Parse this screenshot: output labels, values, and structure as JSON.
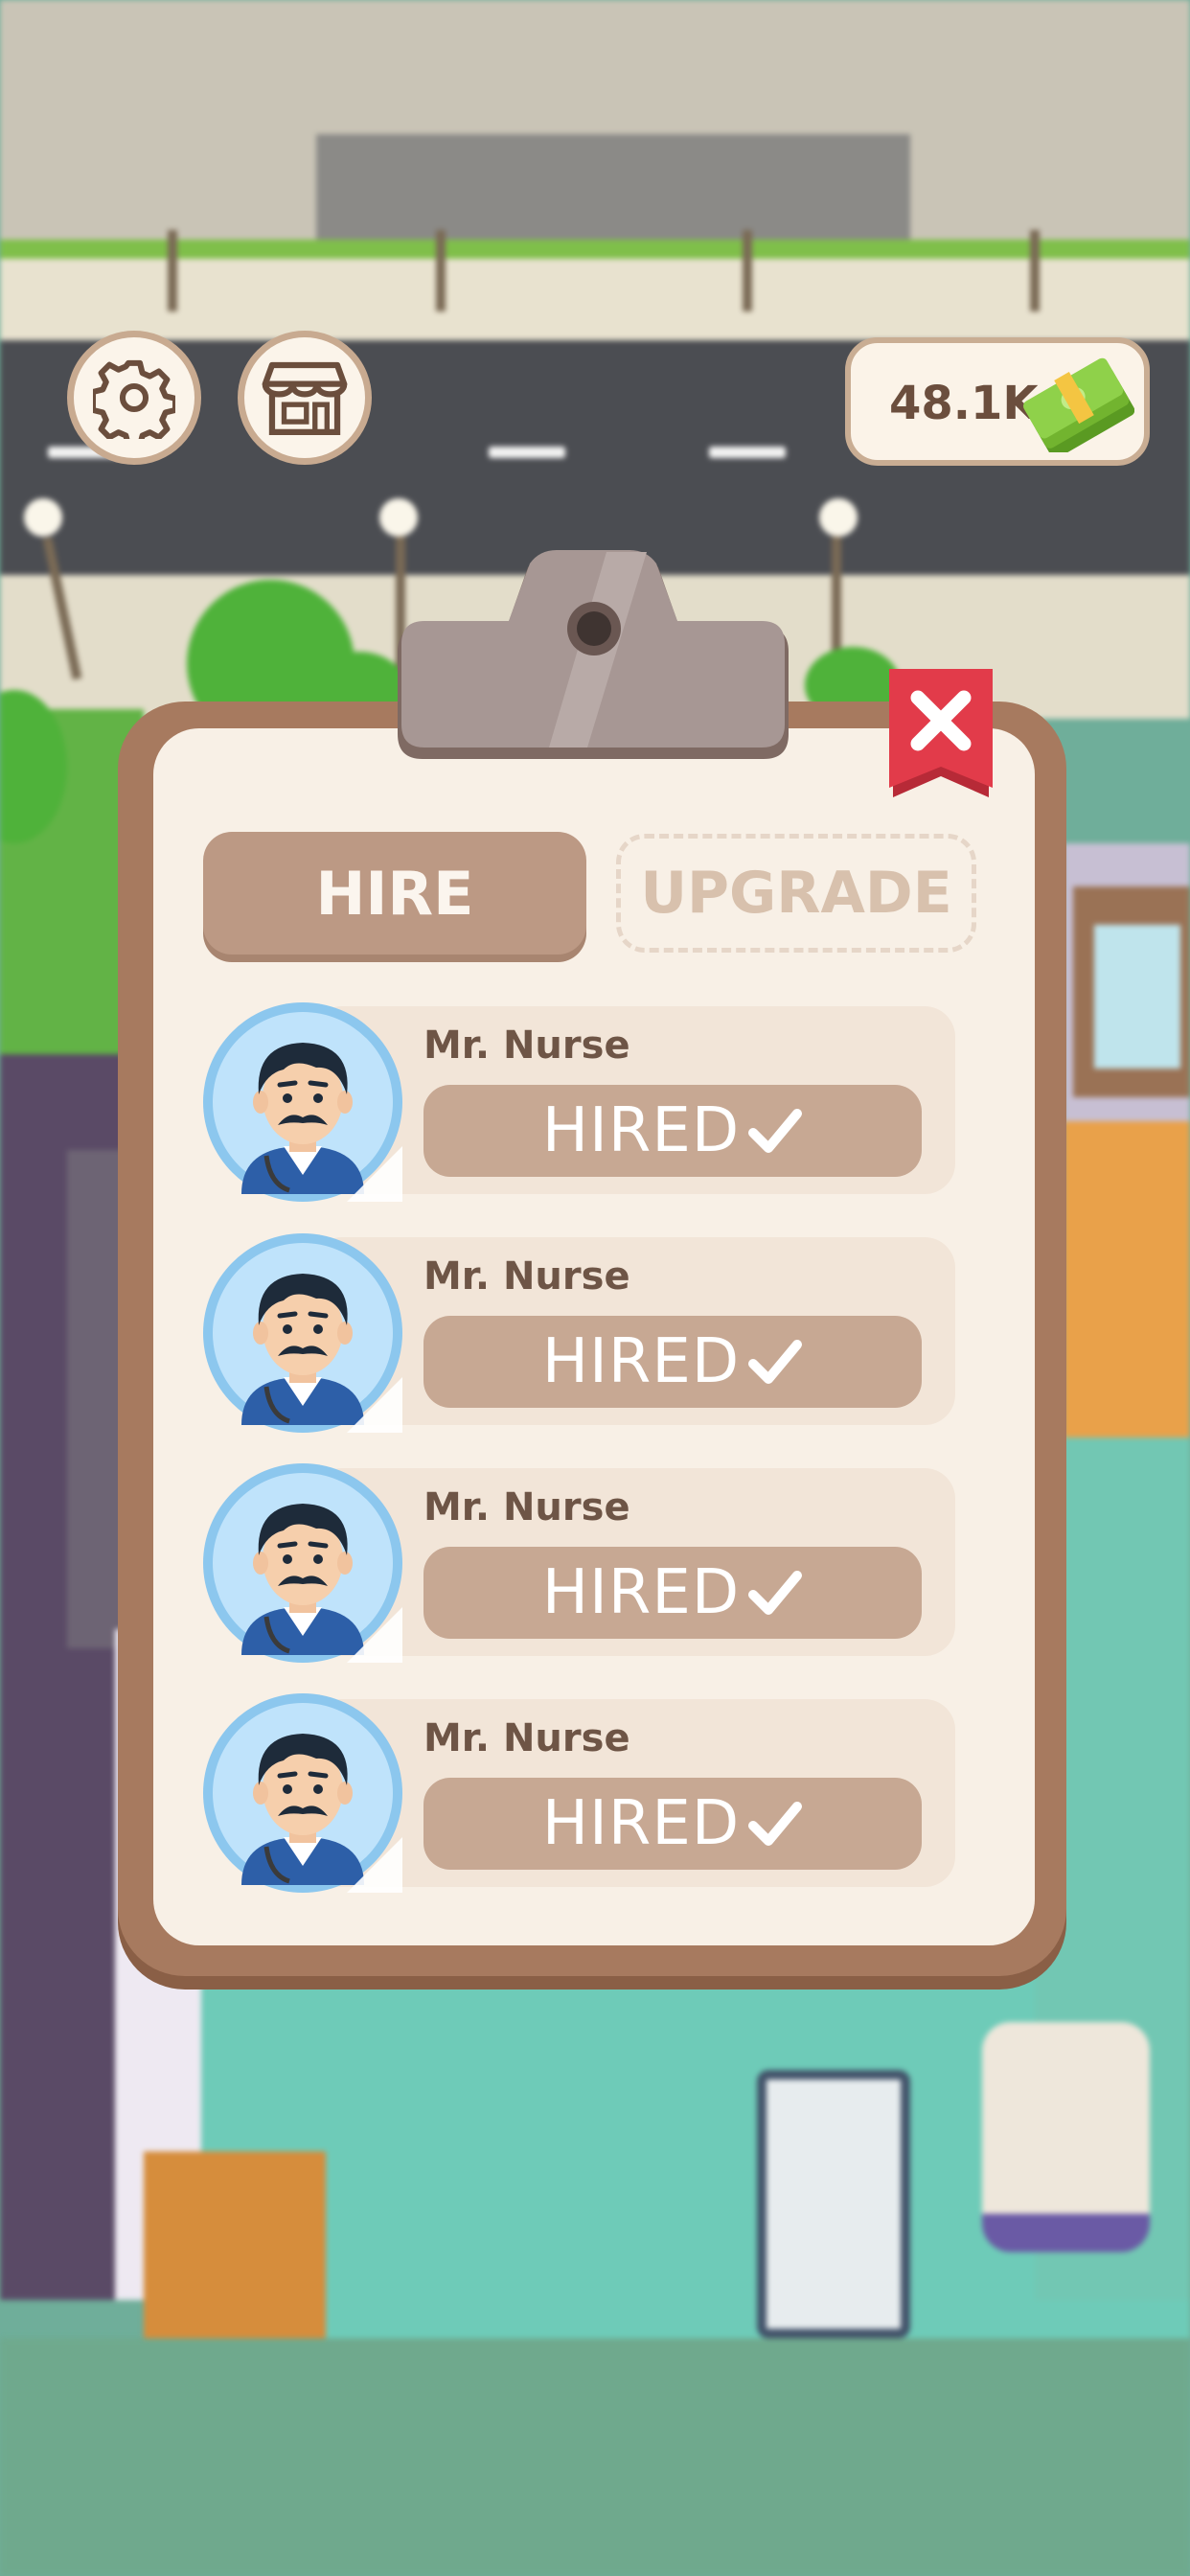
{
  "hud": {
    "settings_icon": "gear-icon",
    "shop_icon": "shop-icon",
    "currency_value": "48.1K",
    "currency_icon": "cash-stack-icon"
  },
  "panel": {
    "close_icon": "close-icon",
    "tabs": [
      {
        "label": "HIRE",
        "active": true
      },
      {
        "label": "UPGRADE",
        "active": false
      }
    ],
    "staff": [
      {
        "name": "Mr. Nurse",
        "status": "HIRED"
      },
      {
        "name": "Mr. Nurse",
        "status": "HIRED"
      },
      {
        "name": "Mr. Nurse",
        "status": "HIRED"
      },
      {
        "name": "Mr. Nurse",
        "status": "HIRED"
      }
    ]
  },
  "colors": {
    "panel_wood": "#a77a5f",
    "paper": "#f8f0e6",
    "hired_button": "#c7a893",
    "close_red": "#e23b4a",
    "cash_green": "#7fc23a"
  }
}
